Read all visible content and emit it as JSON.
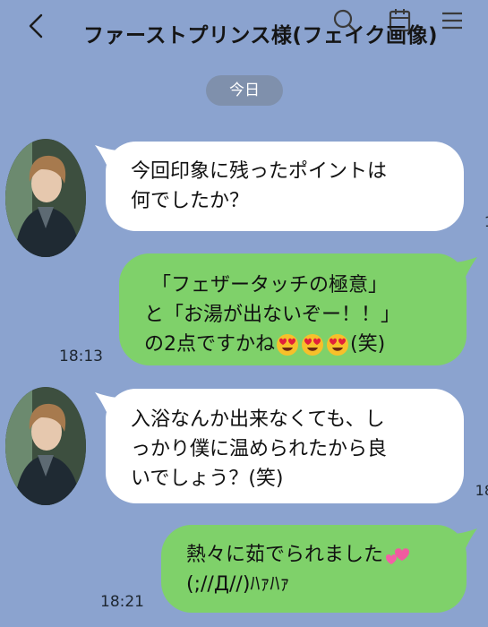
{
  "header": {
    "title": "ファーストプリンス様(フェイク画像)",
    "back_icon": "chevron-left-icon",
    "search_icon": "search-icon",
    "calendar_icon": "calendar-icon",
    "menu_icon": "menu-icon"
  },
  "date_separator": "今日",
  "messages": [
    {
      "side": "in",
      "lines": [
        "今回印象に残ったポイントは",
        "何でしたか？"
      ],
      "edge_time_fragment": "1"
    },
    {
      "side": "out",
      "lines": [
        "「フェザータッチの極意」",
        "と「お湯が出ないぞー！！」",
        "の2点ですかね"
      ],
      "suffix": "(笑)",
      "emoji": "heart-eyes-face-icon",
      "emoji_count": 3,
      "time": "18:13"
    },
    {
      "side": "in",
      "lines": [
        "入浴なんか出来なくても、し",
        "っかり僕に温められたから良",
        "いでしょう？(笑)"
      ],
      "edge_time_fragment": "18"
    },
    {
      "side": "out",
      "lines": [
        "熱々に茹でられました",
        "(;//Д//)ﾊｧﾊｧ"
      ],
      "emoji": "two-hearts-icon",
      "time": "18:21"
    }
  ],
  "colors": {
    "background": "#8ba3cf",
    "incoming_bubble": "#ffffff",
    "outgoing_bubble": "#7fd16a",
    "date_pill": "#7f90ac"
  }
}
